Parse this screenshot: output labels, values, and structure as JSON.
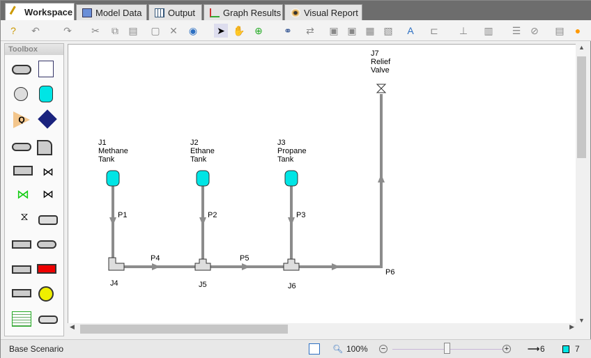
{
  "tabs": [
    {
      "label": "Workspace",
      "active": true
    },
    {
      "label": "Model Data"
    },
    {
      "label": "Output"
    },
    {
      "label": "Graph Results"
    },
    {
      "label": "Visual Report"
    }
  ],
  "toolbox": {
    "title": "Toolbox"
  },
  "canvas": {
    "junctions": [
      {
        "id": "J1",
        "lines": [
          "Methane",
          "Tank"
        ],
        "type": "tank"
      },
      {
        "id": "J2",
        "lines": [
          "Ethane",
          "Tank"
        ],
        "type": "tank"
      },
      {
        "id": "J3",
        "lines": [
          "Propane",
          "Tank"
        ],
        "type": "tank"
      },
      {
        "id": "J4",
        "type": "elbow"
      },
      {
        "id": "J5",
        "type": "tee"
      },
      {
        "id": "J6",
        "type": "tee"
      },
      {
        "id": "J7",
        "lines": [
          "Relief",
          "Valve"
        ],
        "type": "relief-valve"
      }
    ],
    "pipes": [
      "P1",
      "P2",
      "P3",
      "P4",
      "P5",
      "P6"
    ]
  },
  "status": {
    "scenario": "Base Scenario",
    "zoom": "100%",
    "zoom_slider_percent": 50,
    "pipe_count": "6",
    "junction_count": "7"
  },
  "colors": {
    "pipe": "#8c8c8c",
    "tank": "#00e5e5",
    "accent": "#2c6fc2"
  }
}
